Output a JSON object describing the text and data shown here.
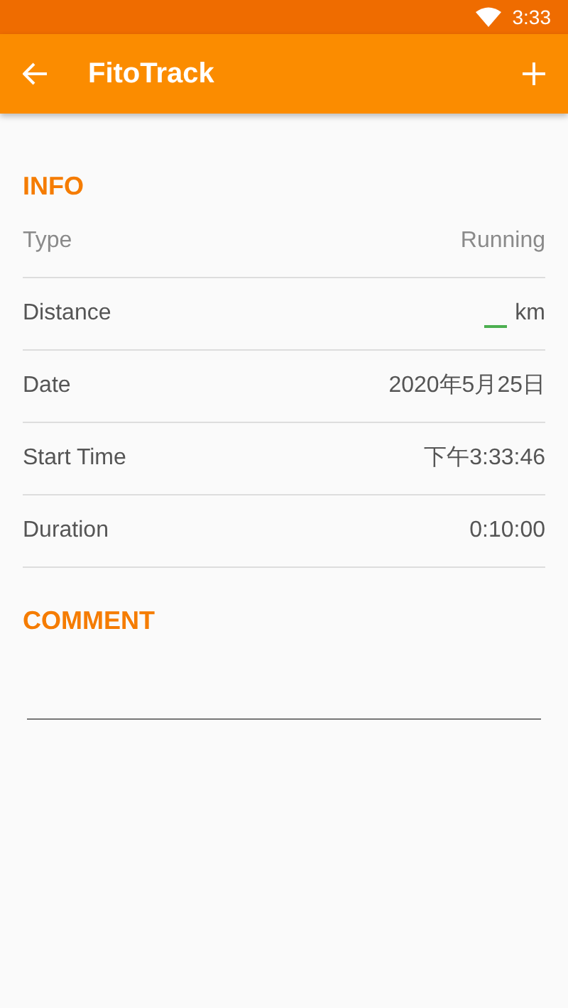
{
  "status_bar": {
    "time": "3:33"
  },
  "app_bar": {
    "title": "FitoTrack"
  },
  "info": {
    "heading": "INFO",
    "rows": [
      {
        "kind": "text",
        "label": "Type",
        "value": "Running",
        "disabled": true
      },
      {
        "kind": "input",
        "label": "Distance",
        "unit": "km",
        "disabled": false
      },
      {
        "kind": "text",
        "label": "Date",
        "value": "2020年5月25日",
        "disabled": false
      },
      {
        "kind": "text",
        "label": "Start Time",
        "value": "下午3:33:46",
        "disabled": false
      },
      {
        "kind": "text",
        "label": "Duration",
        "value": "0:10:00",
        "disabled": false
      }
    ]
  },
  "comment": {
    "heading": "COMMENT"
  }
}
